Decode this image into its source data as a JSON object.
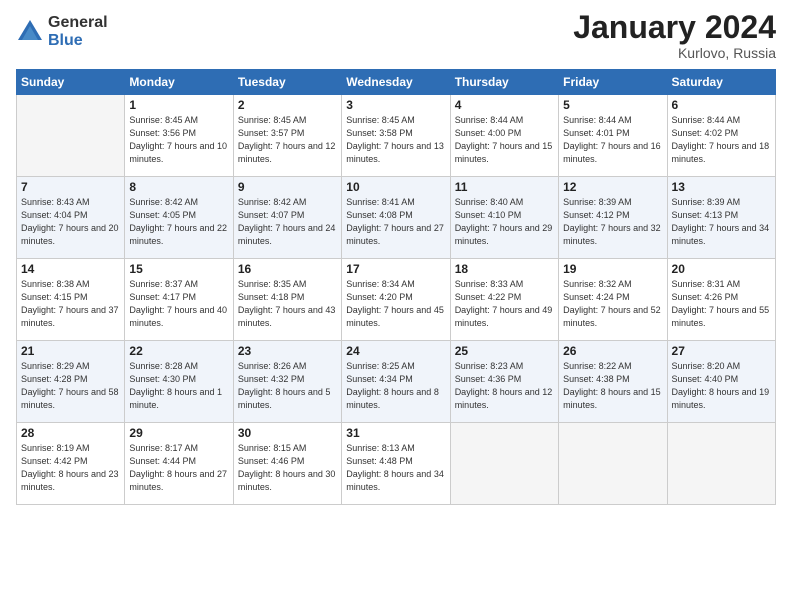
{
  "logo": {
    "general": "General",
    "blue": "Blue"
  },
  "title": "January 2024",
  "subtitle": "Kurlovo, Russia",
  "days_header": [
    "Sunday",
    "Monday",
    "Tuesday",
    "Wednesday",
    "Thursday",
    "Friday",
    "Saturday"
  ],
  "weeks": [
    [
      {
        "num": "",
        "empty": true
      },
      {
        "num": "1",
        "sunrise": "Sunrise: 8:45 AM",
        "sunset": "Sunset: 3:56 PM",
        "daylight": "Daylight: 7 hours and 10 minutes."
      },
      {
        "num": "2",
        "sunrise": "Sunrise: 8:45 AM",
        "sunset": "Sunset: 3:57 PM",
        "daylight": "Daylight: 7 hours and 12 minutes."
      },
      {
        "num": "3",
        "sunrise": "Sunrise: 8:45 AM",
        "sunset": "Sunset: 3:58 PM",
        "daylight": "Daylight: 7 hours and 13 minutes."
      },
      {
        "num": "4",
        "sunrise": "Sunrise: 8:44 AM",
        "sunset": "Sunset: 4:00 PM",
        "daylight": "Daylight: 7 hours and 15 minutes."
      },
      {
        "num": "5",
        "sunrise": "Sunrise: 8:44 AM",
        "sunset": "Sunset: 4:01 PM",
        "daylight": "Daylight: 7 hours and 16 minutes."
      },
      {
        "num": "6",
        "sunrise": "Sunrise: 8:44 AM",
        "sunset": "Sunset: 4:02 PM",
        "daylight": "Daylight: 7 hours and 18 minutes."
      }
    ],
    [
      {
        "num": "7",
        "sunrise": "Sunrise: 8:43 AM",
        "sunset": "Sunset: 4:04 PM",
        "daylight": "Daylight: 7 hours and 20 minutes."
      },
      {
        "num": "8",
        "sunrise": "Sunrise: 8:42 AM",
        "sunset": "Sunset: 4:05 PM",
        "daylight": "Daylight: 7 hours and 22 minutes."
      },
      {
        "num": "9",
        "sunrise": "Sunrise: 8:42 AM",
        "sunset": "Sunset: 4:07 PM",
        "daylight": "Daylight: 7 hours and 24 minutes."
      },
      {
        "num": "10",
        "sunrise": "Sunrise: 8:41 AM",
        "sunset": "Sunset: 4:08 PM",
        "daylight": "Daylight: 7 hours and 27 minutes."
      },
      {
        "num": "11",
        "sunrise": "Sunrise: 8:40 AM",
        "sunset": "Sunset: 4:10 PM",
        "daylight": "Daylight: 7 hours and 29 minutes."
      },
      {
        "num": "12",
        "sunrise": "Sunrise: 8:39 AM",
        "sunset": "Sunset: 4:12 PM",
        "daylight": "Daylight: 7 hours and 32 minutes."
      },
      {
        "num": "13",
        "sunrise": "Sunrise: 8:39 AM",
        "sunset": "Sunset: 4:13 PM",
        "daylight": "Daylight: 7 hours and 34 minutes."
      }
    ],
    [
      {
        "num": "14",
        "sunrise": "Sunrise: 8:38 AM",
        "sunset": "Sunset: 4:15 PM",
        "daylight": "Daylight: 7 hours and 37 minutes."
      },
      {
        "num": "15",
        "sunrise": "Sunrise: 8:37 AM",
        "sunset": "Sunset: 4:17 PM",
        "daylight": "Daylight: 7 hours and 40 minutes."
      },
      {
        "num": "16",
        "sunrise": "Sunrise: 8:35 AM",
        "sunset": "Sunset: 4:18 PM",
        "daylight": "Daylight: 7 hours and 43 minutes."
      },
      {
        "num": "17",
        "sunrise": "Sunrise: 8:34 AM",
        "sunset": "Sunset: 4:20 PM",
        "daylight": "Daylight: 7 hours and 45 minutes."
      },
      {
        "num": "18",
        "sunrise": "Sunrise: 8:33 AM",
        "sunset": "Sunset: 4:22 PM",
        "daylight": "Daylight: 7 hours and 49 minutes."
      },
      {
        "num": "19",
        "sunrise": "Sunrise: 8:32 AM",
        "sunset": "Sunset: 4:24 PM",
        "daylight": "Daylight: 7 hours and 52 minutes."
      },
      {
        "num": "20",
        "sunrise": "Sunrise: 8:31 AM",
        "sunset": "Sunset: 4:26 PM",
        "daylight": "Daylight: 7 hours and 55 minutes."
      }
    ],
    [
      {
        "num": "21",
        "sunrise": "Sunrise: 8:29 AM",
        "sunset": "Sunset: 4:28 PM",
        "daylight": "Daylight: 7 hours and 58 minutes."
      },
      {
        "num": "22",
        "sunrise": "Sunrise: 8:28 AM",
        "sunset": "Sunset: 4:30 PM",
        "daylight": "Daylight: 8 hours and 1 minute."
      },
      {
        "num": "23",
        "sunrise": "Sunrise: 8:26 AM",
        "sunset": "Sunset: 4:32 PM",
        "daylight": "Daylight: 8 hours and 5 minutes."
      },
      {
        "num": "24",
        "sunrise": "Sunrise: 8:25 AM",
        "sunset": "Sunset: 4:34 PM",
        "daylight": "Daylight: 8 hours and 8 minutes."
      },
      {
        "num": "25",
        "sunrise": "Sunrise: 8:23 AM",
        "sunset": "Sunset: 4:36 PM",
        "daylight": "Daylight: 8 hours and 12 minutes."
      },
      {
        "num": "26",
        "sunrise": "Sunrise: 8:22 AM",
        "sunset": "Sunset: 4:38 PM",
        "daylight": "Daylight: 8 hours and 15 minutes."
      },
      {
        "num": "27",
        "sunrise": "Sunrise: 8:20 AM",
        "sunset": "Sunset: 4:40 PM",
        "daylight": "Daylight: 8 hours and 19 minutes."
      }
    ],
    [
      {
        "num": "28",
        "sunrise": "Sunrise: 8:19 AM",
        "sunset": "Sunset: 4:42 PM",
        "daylight": "Daylight: 8 hours and 23 minutes."
      },
      {
        "num": "29",
        "sunrise": "Sunrise: 8:17 AM",
        "sunset": "Sunset: 4:44 PM",
        "daylight": "Daylight: 8 hours and 27 minutes."
      },
      {
        "num": "30",
        "sunrise": "Sunrise: 8:15 AM",
        "sunset": "Sunset: 4:46 PM",
        "daylight": "Daylight: 8 hours and 30 minutes."
      },
      {
        "num": "31",
        "sunrise": "Sunrise: 8:13 AM",
        "sunset": "Sunset: 4:48 PM",
        "daylight": "Daylight: 8 hours and 34 minutes."
      },
      {
        "num": "",
        "empty": true
      },
      {
        "num": "",
        "empty": true
      },
      {
        "num": "",
        "empty": true
      }
    ]
  ]
}
